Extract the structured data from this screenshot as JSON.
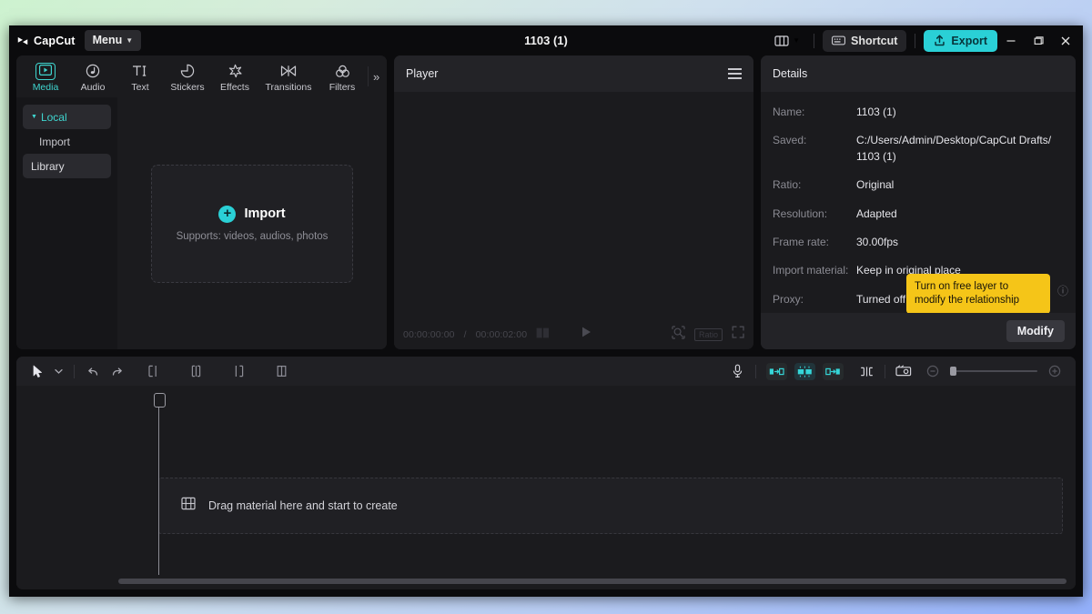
{
  "titlebar": {
    "brand": "CapCut",
    "menu_label": "Menu",
    "doc_title": "1103 (1)",
    "shortcut_label": "Shortcut",
    "export_label": "Export",
    "minimize": "minimize-icon",
    "maximize": "maximize-icon",
    "close": "close-icon",
    "accent_cyan": "#2ad0d6"
  },
  "media_panel": {
    "tabs": [
      {
        "label": "Media",
        "icon": "media-play-icon",
        "active": true
      },
      {
        "label": "Audio",
        "icon": "audio-note-icon",
        "active": false
      },
      {
        "label": "Text",
        "icon": "text-ti-icon",
        "active": false
      },
      {
        "label": "Stickers",
        "icon": "sticker-icon",
        "active": false
      },
      {
        "label": "Effects",
        "icon": "effects-sparkle-icon",
        "active": false
      },
      {
        "label": "Transitions",
        "icon": "transitions-bowtie-icon",
        "active": false
      },
      {
        "label": "Filters",
        "icon": "filters-circles-icon",
        "active": false
      }
    ],
    "more_label": "»",
    "sidebar": [
      {
        "label": "Local",
        "state": "selected"
      },
      {
        "label": "Import",
        "state": "sub"
      },
      {
        "label": "Library",
        "state": "button"
      }
    ],
    "import_box": {
      "label": "Import",
      "sublabel": "Supports: videos, audios, photos",
      "plus": "+"
    }
  },
  "player": {
    "title": "Player",
    "menu_icon": "hamburger-icon",
    "current_time": "00:00:00:00",
    "time_separator": "/",
    "total_time": "00:00:02:00",
    "play_icon": "play-icon",
    "zoom_icon": "magnifier-icon",
    "ratio_label": "Ratio",
    "fullscreen_icon": "fullscreen-icon"
  },
  "details": {
    "title": "Details",
    "rows": [
      {
        "label": "Name:",
        "value": "1103 (1)"
      },
      {
        "label": "Saved:",
        "value": "C:/Users/Admin/Desktop/CapCut Drafts/ 1103 (1)"
      },
      {
        "label": "Ratio:",
        "value": "Original"
      },
      {
        "label": "Resolution:",
        "value": "Adapted"
      },
      {
        "label": "Frame rate:",
        "value": "30.00fps"
      },
      {
        "label": "Import material:",
        "value": "Keep in original place"
      },
      {
        "label": "Proxy:",
        "value": "Turned off"
      }
    ],
    "tooltip": "Turn on free layer to modify the relationship",
    "tooltip_bg": "#f5c518",
    "help_icon": "question-circle-icon",
    "modify_label": "Modify"
  },
  "timeline": {
    "tools_left": [
      "cursor-icon",
      "chevron-down-icon",
      "undo-icon",
      "redo-icon",
      "split-left-icon",
      "split-icon",
      "split-right-icon",
      "delete-icon"
    ],
    "tools_right": [
      "microphone-icon",
      "clip-in-icon",
      "keyframe-icon",
      "clip-out-icon",
      "split-clip-icon",
      "crop-icon",
      "zoom-out-icon",
      "zoom-in-icon"
    ],
    "drop_hint": "Drag material here and start to create",
    "drop_icon": "film-strip-icon",
    "playhead_position": "00:00:00:00"
  }
}
